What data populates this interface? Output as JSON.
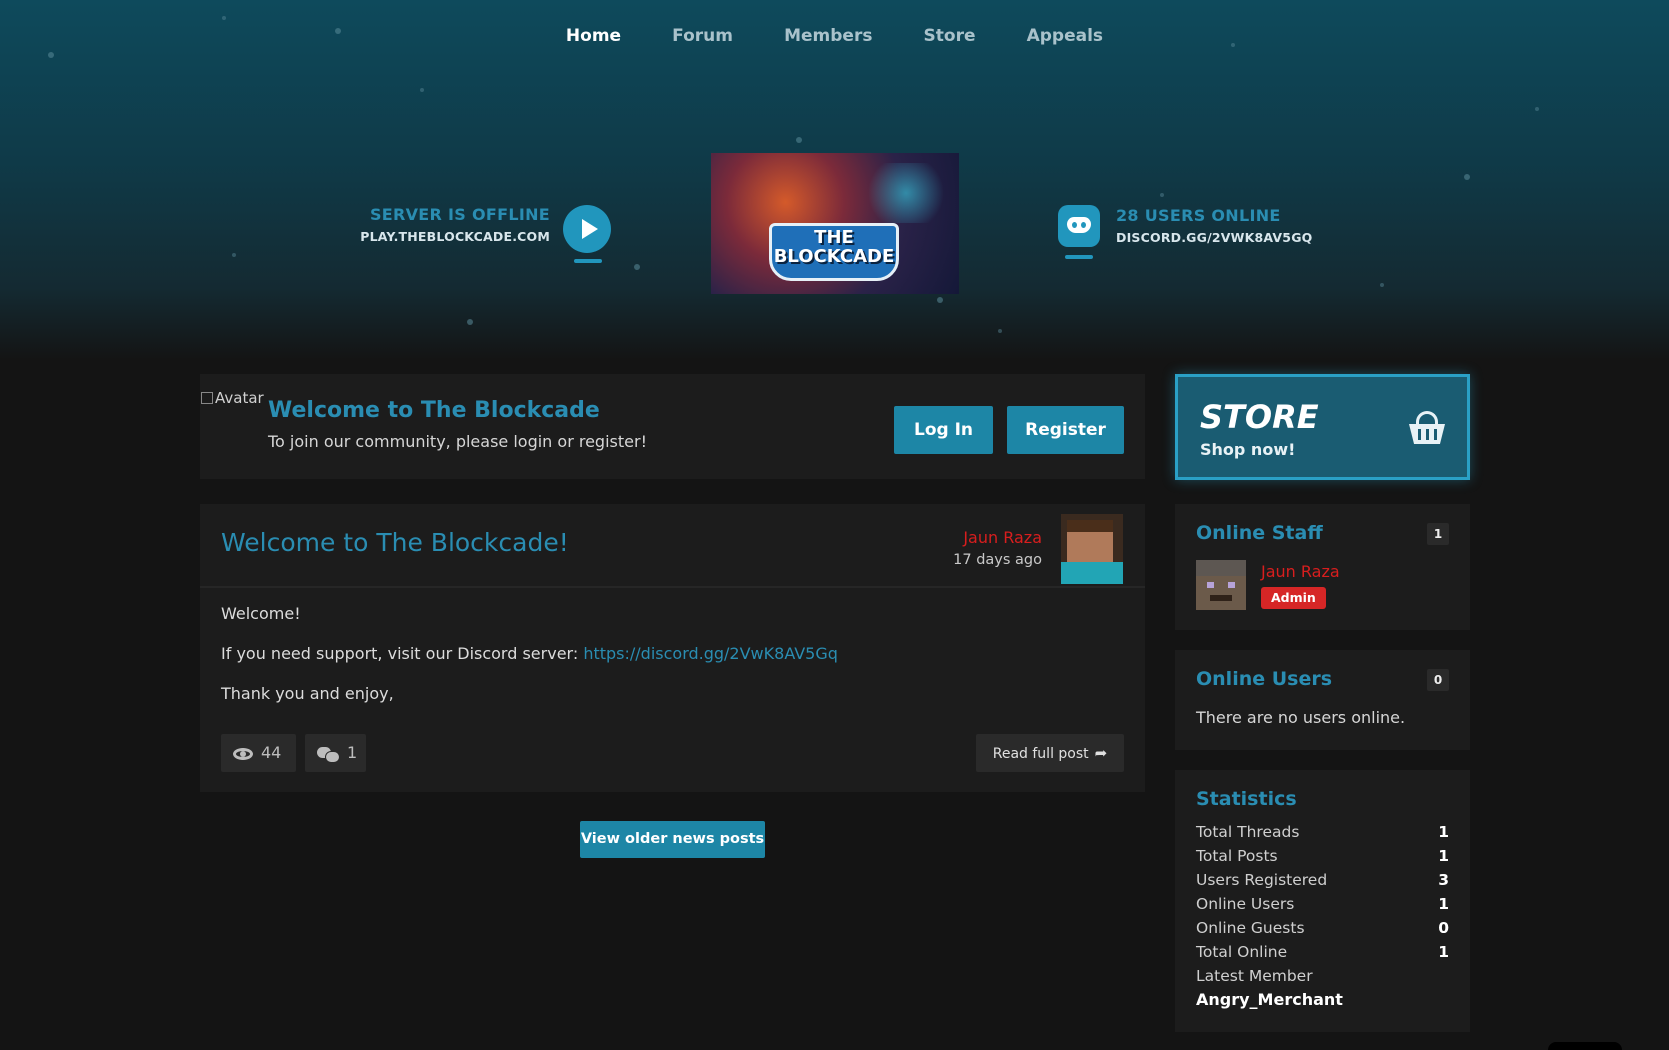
{
  "nav": {
    "items": [
      {
        "label": "Home",
        "active": true
      },
      {
        "label": "Forum",
        "active": false
      },
      {
        "label": "Members",
        "active": false
      },
      {
        "label": "Store",
        "active": false
      },
      {
        "label": "Appeals",
        "active": false
      }
    ]
  },
  "server": {
    "status": "SERVER IS OFFLINE",
    "address": "PLAY.THEBLOCKCADE.COM",
    "icon": "play-icon"
  },
  "discord": {
    "online": "28 USERS ONLINE",
    "invite": "DISCORD.GG/2VWK8AV5GQ",
    "icon": "discord-icon"
  },
  "banner": {
    "logo_line1": "THE",
    "logo_line2": "BLOCKCADE"
  },
  "welcome": {
    "avatar_alt": "Avatar",
    "title": "Welcome to The Blockcade",
    "subtitle": "To join our community, please login or register!",
    "login_label": "Log In",
    "register_label": "Register"
  },
  "post": {
    "title": "Welcome to The Blockcade!",
    "author": "Jaun Raza",
    "time_ago": "17 days ago",
    "line1": "Welcome!",
    "line2_prefix": "If you need support, visit our Discord server: ",
    "line2_link": "https://discord.gg/2VwK8AV5Gq",
    "line3": "Thank you and enjoy,",
    "views": "44",
    "comments": "1",
    "read_more": "Read full post"
  },
  "older_posts_label": "View older news posts",
  "store": {
    "title": "STORE",
    "subtitle": "Shop now!",
    "icon": "basket-icon"
  },
  "online_staff": {
    "title": "Online Staff",
    "count": "1",
    "members": [
      {
        "name": "Jaun Raza",
        "role": "Admin"
      }
    ]
  },
  "online_users": {
    "title": "Online Users",
    "count": "0",
    "empty_text": "There are no users online."
  },
  "statistics": {
    "title": "Statistics",
    "rows": [
      {
        "label": "Total Threads",
        "value": "1"
      },
      {
        "label": "Total Posts",
        "value": "1"
      },
      {
        "label": "Users Registered",
        "value": "3"
      },
      {
        "label": "Online Users",
        "value": "1"
      },
      {
        "label": "Online Guests",
        "value": "0"
      },
      {
        "label": "Total Online",
        "value": "1"
      },
      {
        "label": "Latest Member",
        "value": ""
      }
    ],
    "latest_member": "Angry_Merchant"
  },
  "colors": {
    "accent": "#2a8db2",
    "button": "#1d86a6",
    "admin": "#d62626",
    "author": "#d81e1e"
  }
}
